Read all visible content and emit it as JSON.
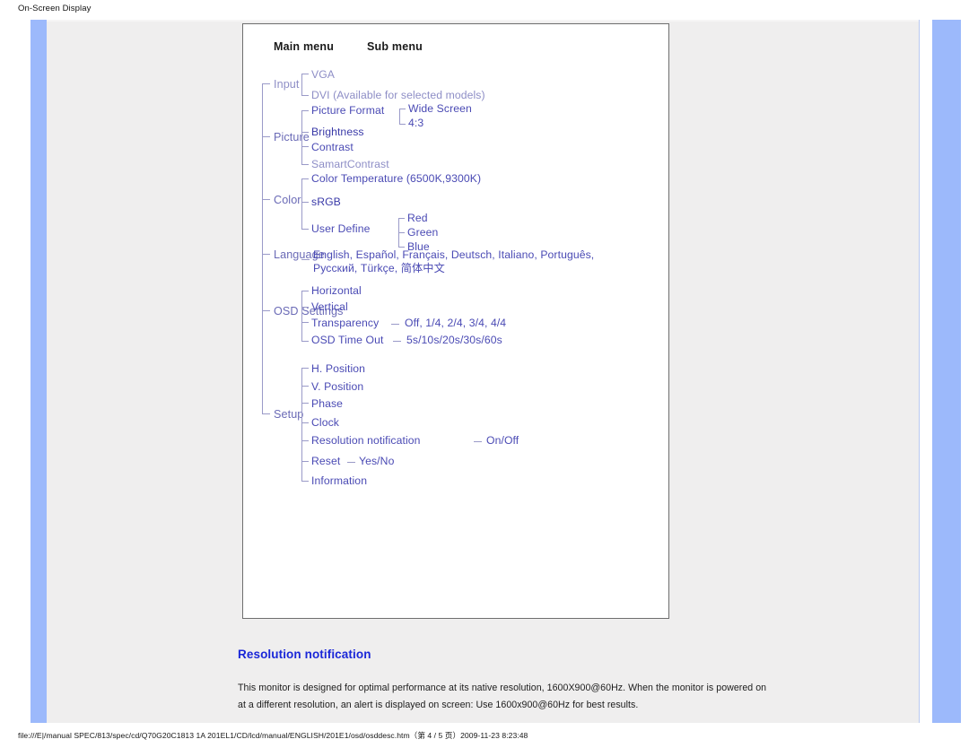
{
  "page": {
    "header": "On-Screen Display",
    "footer": "file:///E|/manual SPEC/813/spec/cd/Q70G20C1813 1A 201EL1/CD/lcd/manual/ENGLISH/201E1/osd/osddesc.htm（第 4 / 5 页）2009-11-23 8:23:48"
  },
  "diagram": {
    "column_headers": {
      "main": "Main menu",
      "sub": "Sub menu"
    },
    "main_items": {
      "input": "Input",
      "picture": "Picture",
      "color": "Color",
      "language": "Language",
      "osd_settings": "OSD Settings",
      "setup": "Setup"
    },
    "input": {
      "vga": "VGA",
      "dvi": "DVI (Available for selected models)"
    },
    "picture": {
      "picture_format": "Picture Format",
      "wide_screen": "Wide Screen",
      "four_three": "4:3",
      "brightness": "Brightness",
      "contrast": "Contrast",
      "samart_contrast": "SamartContrast"
    },
    "color": {
      "color_temperature": "Color Temperature (6500K,9300K)",
      "srgb": "sRGB",
      "user_define": "User Define",
      "red": "Red",
      "green": "Green",
      "blue": "Blue"
    },
    "language": {
      "list": "English, Español, Français, Deutsch, Italiano, Português, Русский, Türkçe, 简体中文"
    },
    "osd_settings": {
      "horizontal": "Horizontal",
      "vertical": "Vertical",
      "transparency": "Transparency",
      "transparency_values": "Off, 1/4, 2/4, 3/4, 4/4",
      "osd_time_out": "OSD Time Out",
      "osd_time_out_values": "5s/10s/20s/30s/60s"
    },
    "setup": {
      "h_position": "H. Position",
      "v_position": "V. Position",
      "phase": "Phase",
      "clock": "Clock",
      "resolution_notification": "Resolution notification",
      "resolution_notification_values": "On/Off",
      "reset": "Reset",
      "reset_values": "Yes/No",
      "information": "Information"
    }
  },
  "notification": {
    "title": "Resolution notification",
    "body": "This monitor is designed for optimal performance at its native resolution, 1600X900@60Hz. When the monitor is powered on at a different resolution, an alert is displayed on screen: Use 1600x900@60Hz for best results."
  },
  "colors": {
    "accent_blue": "#1a27d8",
    "tree_purple": "#4a4ab4",
    "bar_blue": "#9cb9fb",
    "panel_gray": "#efeeee"
  }
}
